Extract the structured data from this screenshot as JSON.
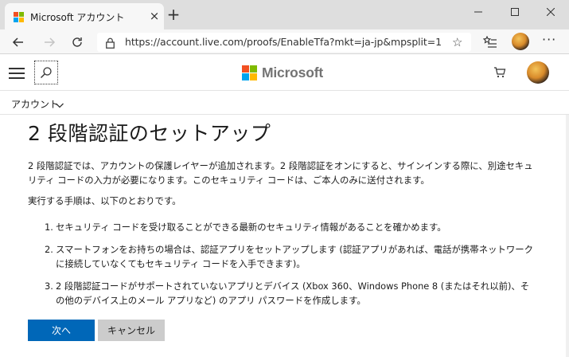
{
  "browser": {
    "tab_title": "Microsoft アカウント",
    "tab_close": "×",
    "new_tab": "+",
    "url": "https://account.live.com/proofs/EnableTfa?mkt=ja-jp&mpsplit=1",
    "more": "···"
  },
  "header": {
    "brand": "Microsoft",
    "logo_colors": [
      "#f25022",
      "#7fba00",
      "#00a4ef",
      "#ffb900"
    ]
  },
  "account_bar": {
    "label": "アカウント"
  },
  "main": {
    "title": "2 段階認証のセットアップ",
    "intro": "2 段階認証では、アカウントの保護レイヤーが追加されます。2 段階認証をオンにすると、サインインする際に、別途セキュリティ コードの入力が必要になります。このセキュリティ コードは、ご本人のみに送付されます。",
    "steps_intro": "実行する手順は、以下のとおりです。",
    "steps": [
      {
        "num": "1.",
        "text": "セキュリティ コードを受け取ることができる最新のセキュリティ情報があることを確かめます。"
      },
      {
        "num": "2.",
        "text": "スマートフォンをお持ちの場合は、認証アプリをセットアップします (認証アプリがあれば、電話が携帯ネットワークに接続していなくてもセキュリティ コードを入手できます)。"
      },
      {
        "num": "3.",
        "text": "2 段階認証コードがサポートされていないアプリとデバイス (Xbox 360、Windows Phone 8 (またはそれ以前)、その他のデバイス上のメール アプリなど) のアプリ パスワードを作成します。"
      }
    ]
  },
  "actions": {
    "next_label": "次へ",
    "cancel_label": "キャンセル",
    "primary_color": "#0067b8",
    "secondary_color": "#cccccc"
  }
}
